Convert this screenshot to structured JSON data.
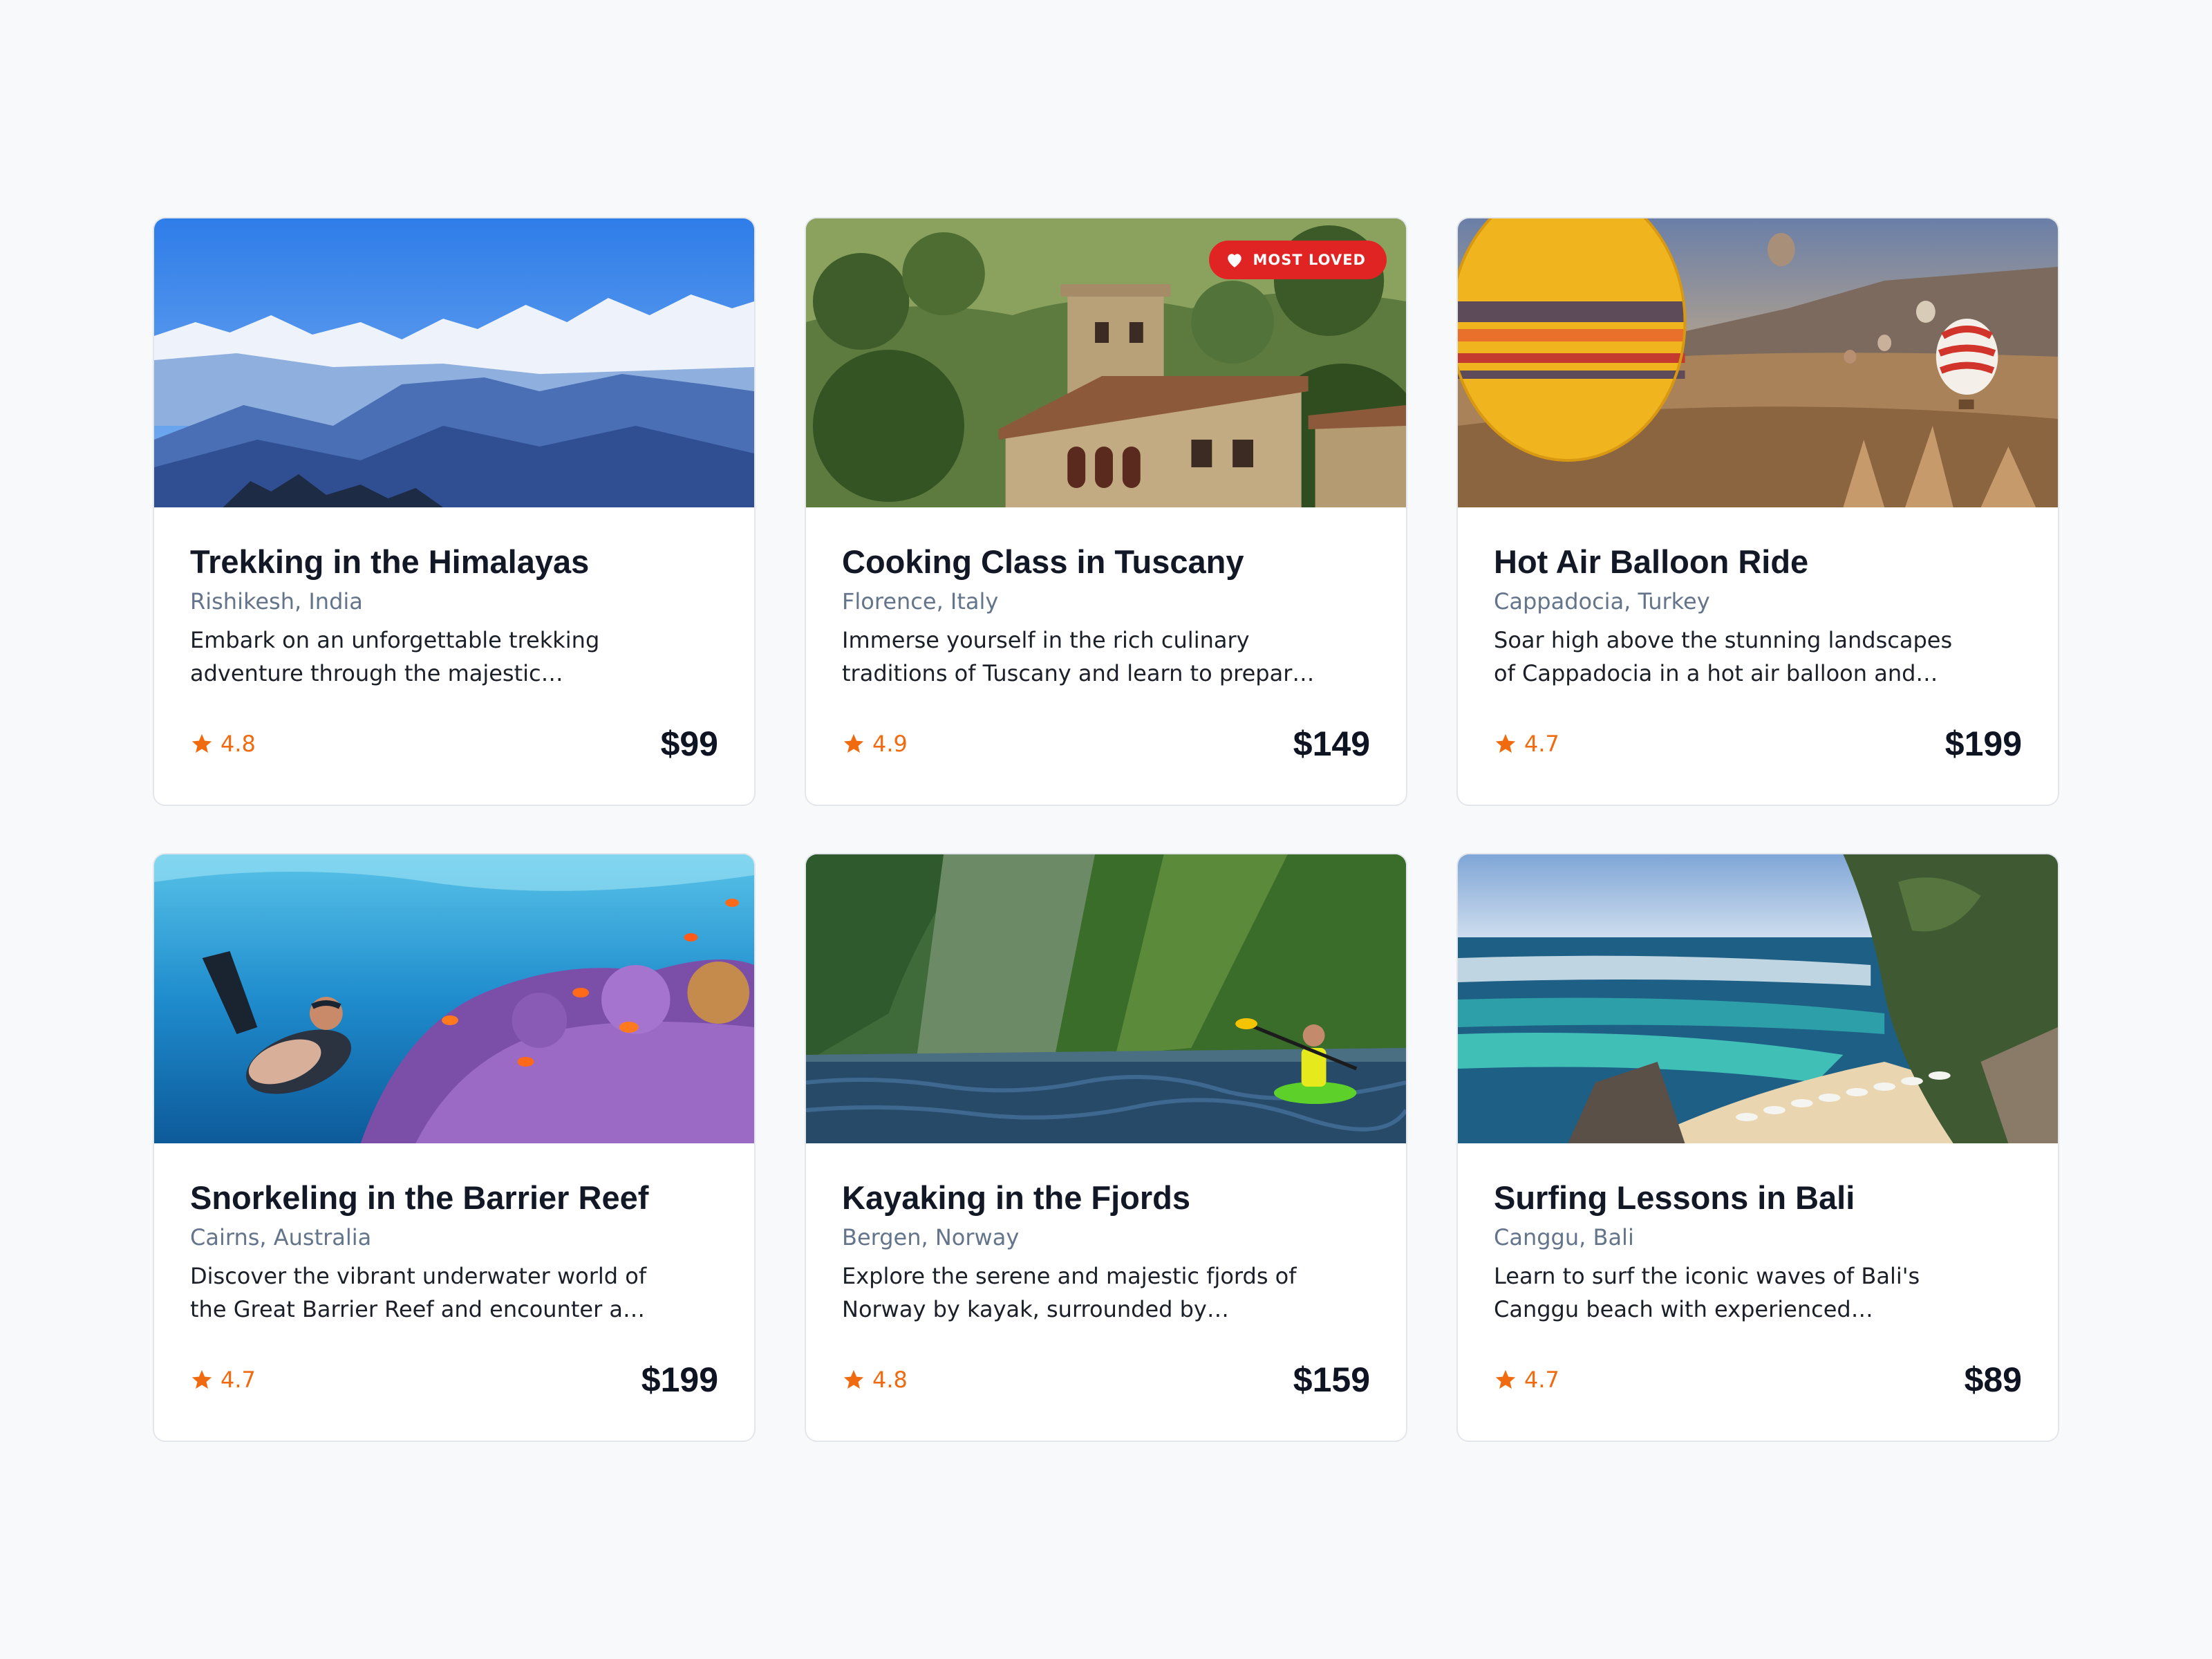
{
  "colors": {
    "page_background": "#f8f9fb",
    "rating": "#f06b0f",
    "badge": "#e02424",
    "location": "#64748b"
  },
  "cards": [
    {
      "title": "Trekking in the Himalayas",
      "location": "Rishikesh, India",
      "description": "Embark on an unforgettable trekking adventure through the majestic Himalaya…",
      "rating": "4.8",
      "price": "$99",
      "image": "himalaya-mountains-photo"
    },
    {
      "title": "Cooking Class in Tuscany",
      "location": "Florence, Italy",
      "description": "Immerse yourself in the rich culinary traditions of Tuscany and learn to prepar…",
      "rating": "4.9",
      "price": "$149",
      "badge": "MOST LOVED",
      "badge_icon": "heart-icon",
      "image": "tuscan-villa-photo"
    },
    {
      "title": "Hot Air Balloon Ride",
      "location": "Cappadocia, Turkey",
      "description": "Soar high above the stunning landscapes of Cappadocia in a hot air balloon and…",
      "rating": "4.7",
      "price": "$199",
      "image": "hot-air-balloons-photo"
    },
    {
      "title": "Snorkeling in the Barrier Reef",
      "location": "Cairns, Australia",
      "description": "Discover the vibrant underwater world of the Great Barrier Reef and encounter a…",
      "rating": "4.7",
      "price": "$199",
      "image": "coral-reef-diver-photo"
    },
    {
      "title": "Kayaking in the Fjords",
      "location": "Bergen, Norway",
      "description": "Explore the serene and majestic fjords of Norway by kayak, surrounded by towerin…",
      "rating": "4.8",
      "price": "$159",
      "image": "fjord-kayaker-photo"
    },
    {
      "title": "Surfing Lessons in Bali",
      "location": "Canggu, Bali",
      "description": "Learn to surf the iconic waves of Bali's Canggu beach with experienced…",
      "rating": "4.7",
      "price": "$89",
      "image": "bali-beach-photo"
    }
  ],
  "rating_icon": "star-icon"
}
